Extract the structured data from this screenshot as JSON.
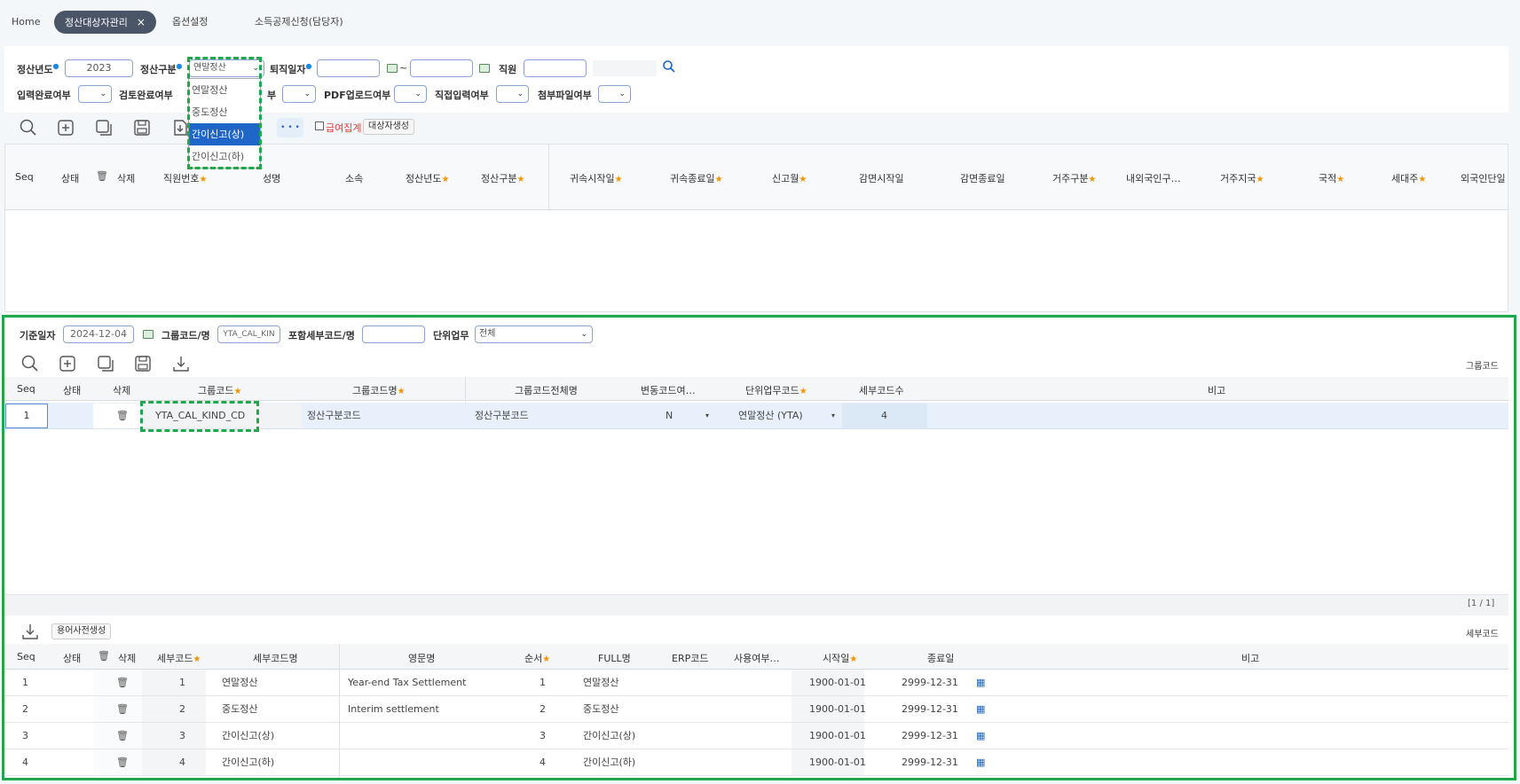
{
  "tabs": [
    {
      "label": "Home"
    },
    {
      "label": "정산대상자관리",
      "close": "×"
    },
    {
      "label": "옵션설정"
    },
    {
      "label": "소득공제신청(담당자)"
    }
  ],
  "filter": {
    "year_label": "정산년도",
    "year_value": "2023",
    "kind_label": "정산구분",
    "kind_value": "연말정산",
    "retire_label": "퇴직일자",
    "tilde": "~",
    "emp_label": "직원",
    "input_done_label": "입력완료여부",
    "review_done_label": "검토완료여부",
    "partial_label": "부",
    "pdf_label": "PDF업로드여부",
    "direct_label": "직접입력여부",
    "attach_label": "첨부파일여부"
  },
  "dropdown": {
    "options": [
      "연말정산",
      "중도정산",
      "간이신고(상)",
      "간이신고(하)"
    ],
    "selected_index": 2
  },
  "toolbar": {
    "more": "• • •",
    "salary_sum": "급여집계",
    "create_target": "대상자생성"
  },
  "main_grid": {
    "headers": [
      "Seq",
      "상태",
      "삭제",
      "직원번호",
      "성명",
      "소속",
      "정산년도",
      "정산구분",
      "귀속시작일",
      "귀속종료일",
      "신고월",
      "감면시작일",
      "감면종료일",
      "거주구분",
      "내외국인구…",
      "거주지국",
      "국적",
      "세대주",
      "외국인단일"
    ]
  },
  "code_panel": {
    "base_date_label": "기준일자",
    "base_date_value": "2024-12-04",
    "group_label": "그룹코드/명",
    "group_value": "YTA_CAL_KIN",
    "detail_label": "포함세부코드/명",
    "unit_label": "단위업무",
    "unit_value": "전체",
    "group_title": "그룹코드",
    "group_headers": [
      "Seq",
      "상태",
      "삭제",
      "그룹코드",
      "그룹코드명",
      "그룹코드전체명",
      "변동코드여…",
      "단위업무코드",
      "세부코드수",
      "비고"
    ],
    "group_row": {
      "seq": "1",
      "code": "YTA_CAL_KIND_CD",
      "name": "정산구분코드",
      "full": "정산구분코드",
      "var": "N",
      "unit": "연말정산 (YTA)",
      "count": "4"
    },
    "pager": "[1 / 1]",
    "dict_btn": "용어사전생성",
    "detail_title": "세부코드",
    "detail_headers": [
      "Seq",
      "상태",
      "삭제",
      "세부코드",
      "세부코드명",
      "영문명",
      "순서",
      "FULL명",
      "ERP코드",
      "사용여부…",
      "시작일",
      "종료일",
      "비고"
    ],
    "detail_rows": [
      {
        "seq": "1",
        "code": "1",
        "name": "연말정산",
        "en": "Year-end Tax Settlement",
        "ord": "1",
        "full": "연말정산",
        "start": "1900-01-01",
        "end": "2999-12-31"
      },
      {
        "seq": "2",
        "code": "2",
        "name": "중도정산",
        "en": "Interim settlement",
        "ord": "2",
        "full": "중도정산",
        "start": "1900-01-01",
        "end": "2999-12-31"
      },
      {
        "seq": "3",
        "code": "3",
        "name": "간이신고(상)",
        "en": "",
        "ord": "3",
        "full": "간이신고(상)",
        "start": "1900-01-01",
        "end": "2999-12-31"
      },
      {
        "seq": "4",
        "code": "4",
        "name": "간이신고(하)",
        "en": "",
        "ord": "4",
        "full": "간이신고(하)",
        "start": "1900-01-01",
        "end": "2999-12-31"
      }
    ]
  },
  "colors": {
    "accent": "#1e66c8",
    "highlight": "#1ea84b",
    "star": "#f29500"
  }
}
